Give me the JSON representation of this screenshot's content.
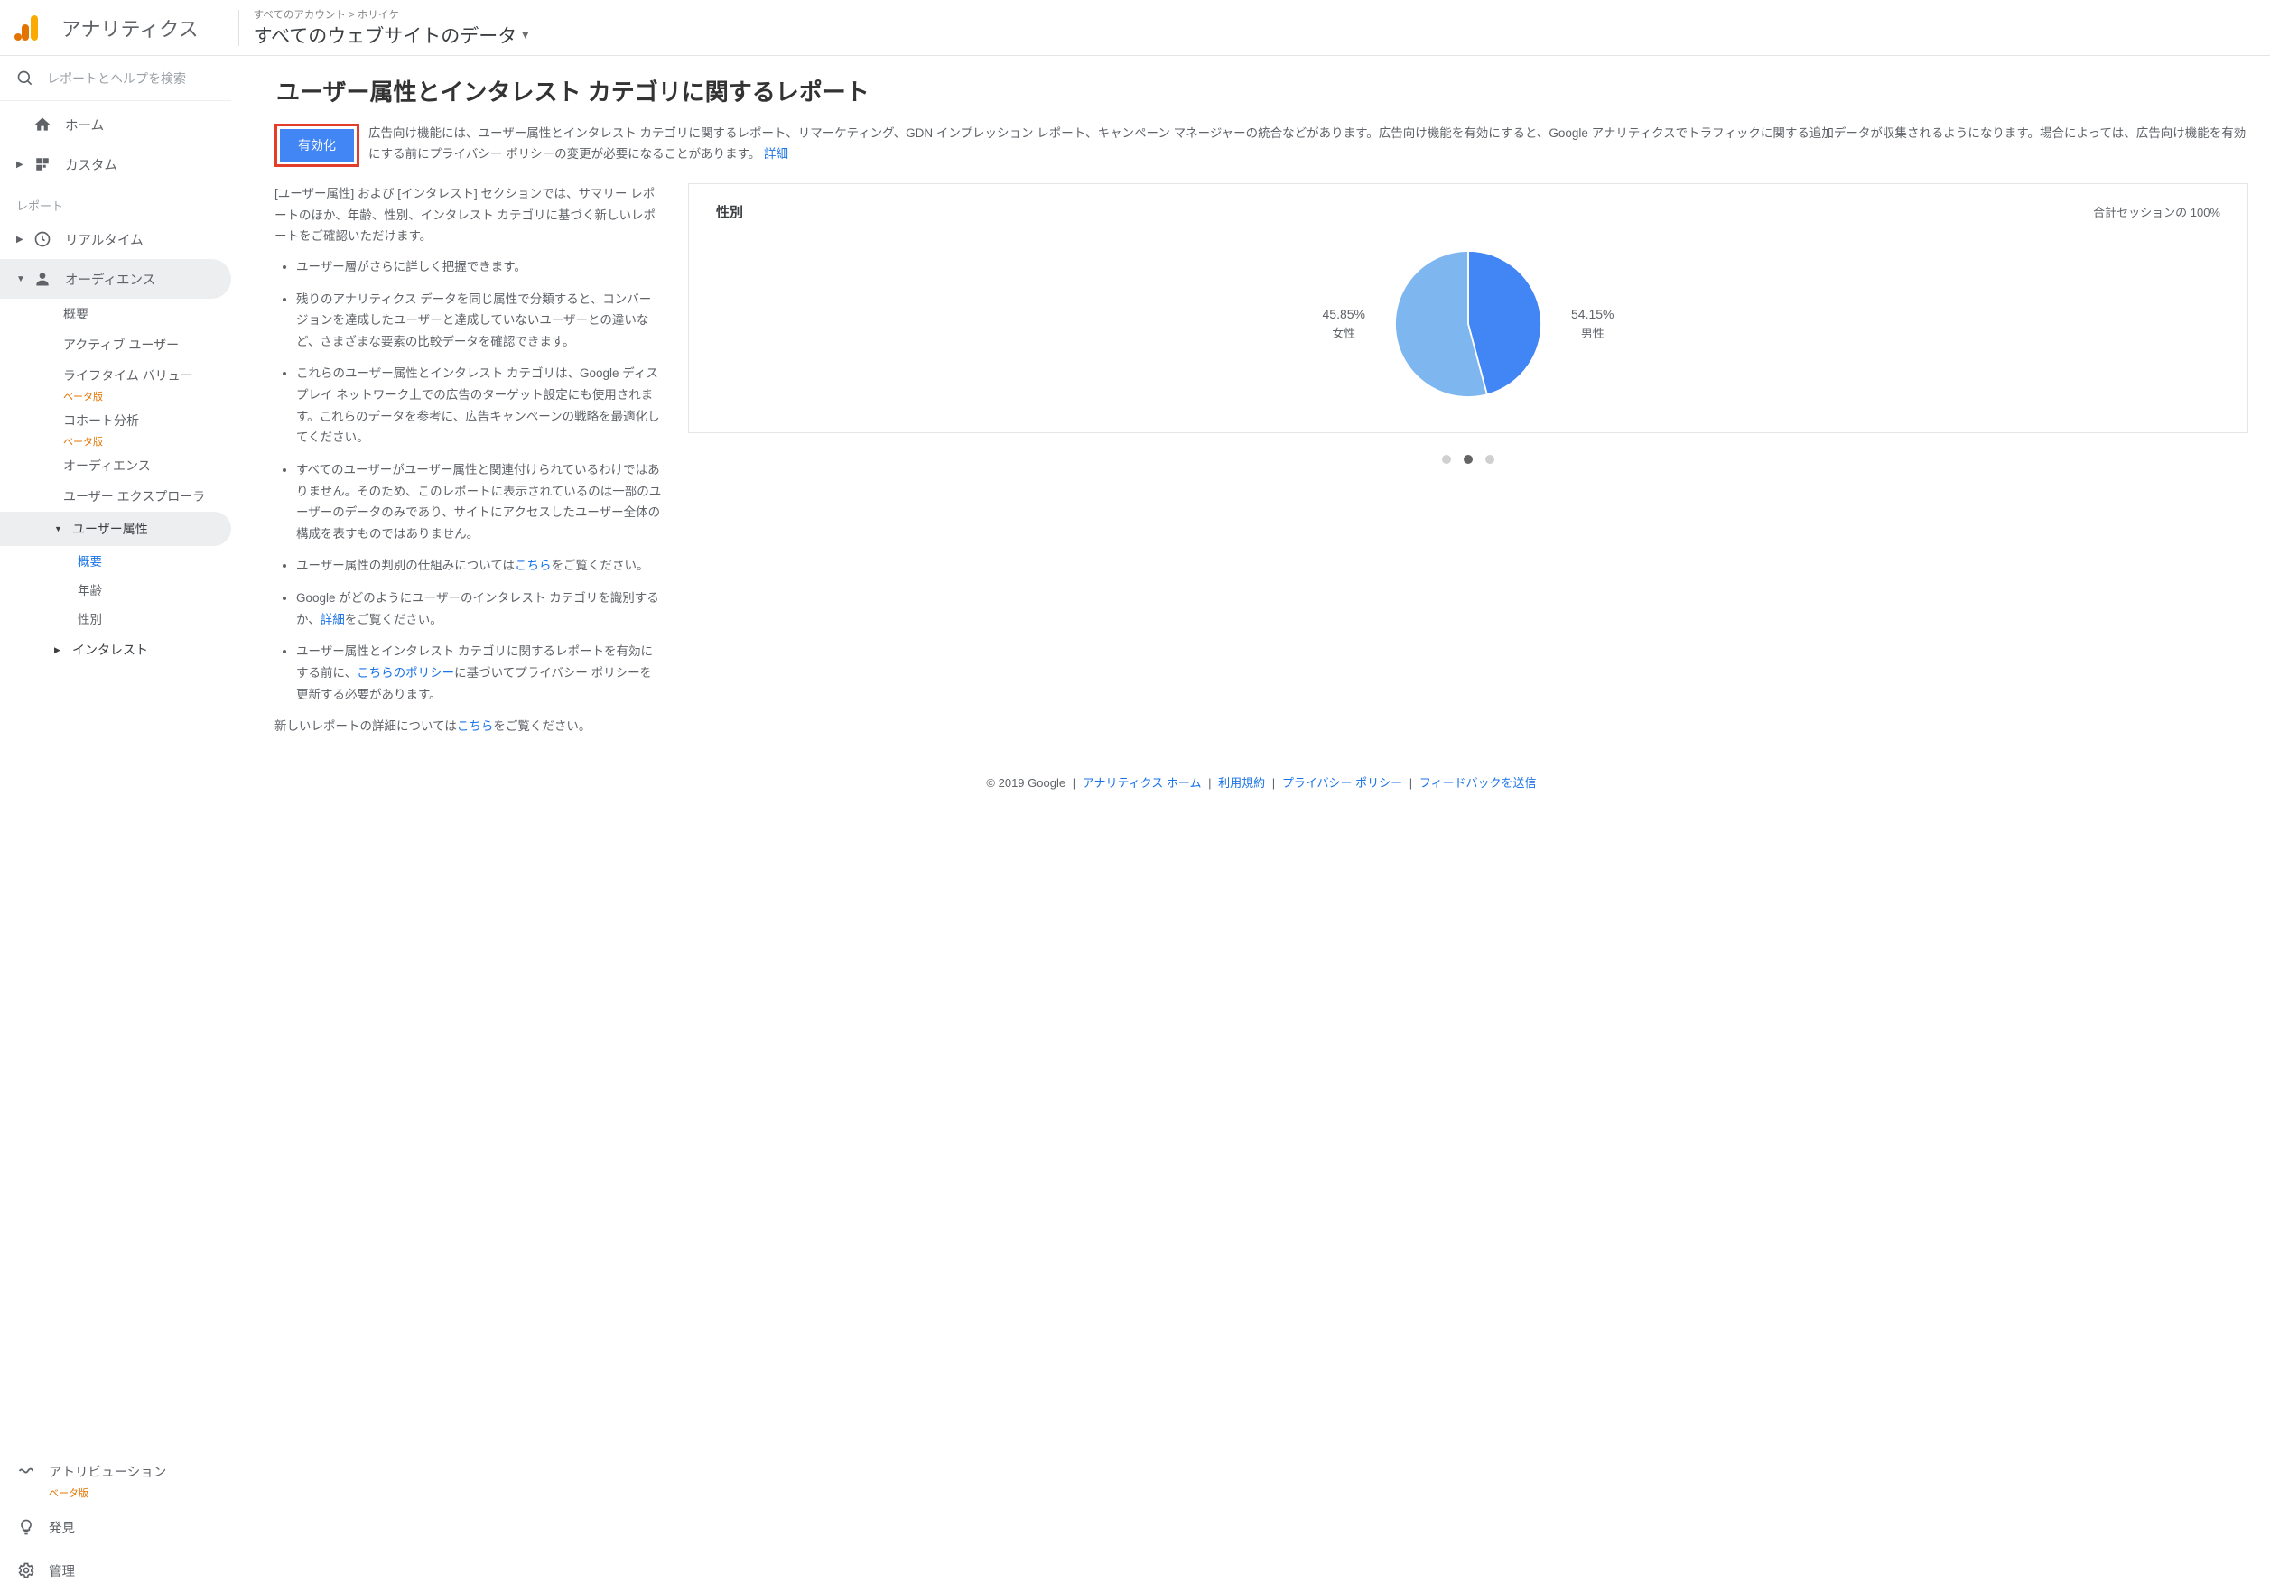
{
  "header": {
    "product_name": "アナリティクス",
    "breadcrumb_small": "すべてのアカウント > ホリイケ",
    "breadcrumb_title": "すべてのウェブサイトのデータ"
  },
  "search": {
    "placeholder": "レポートとヘルプを検索"
  },
  "nav": {
    "home": "ホーム",
    "custom": "カスタム",
    "section_label": "レポート",
    "realtime": "リアルタイム",
    "audience": "オーディエンス",
    "audience_sub": {
      "overview": "概要",
      "active_users": "アクティブ ユーザー",
      "lifetime_value": "ライフタイム バリュー",
      "beta": "ベータ版",
      "cohort": "コホート分析",
      "audiences": "オーディエンス",
      "user_explorer": "ユーザー エクスプローラ",
      "demographics": "ユーザー属性",
      "demo_overview": "概要",
      "demo_age": "年齢",
      "demo_gender": "性別",
      "interests": "インタレスト"
    },
    "attribution": "アトリビューション",
    "discover": "発見",
    "admin": "管理"
  },
  "main": {
    "title": "ユーザー属性とインタレスト カテゴリに関するレポート",
    "enable_button": "有効化",
    "intro": "広告向け機能には、ユーザー属性とインタレスト カテゴリに関するレポート、リマーケティング、GDN インプレッション レポート、キャンペーン マネージャーの統合などがあります。広告向け機能を有効にすると、Google アナリティクスでトラフィックに関する追加データが収集されるようになります。場合によっては、広告向け機能を有効にする前にプライバシー ポリシーの変更が必要になることがあります。",
    "intro_link": "詳細",
    "desc_intro": "[ユーザー属性] および [インタレスト] セクションでは、サマリー レポートのほか、年齢、性別、インタレスト カテゴリに基づく新しいレポートをご確認いただけます。",
    "bullets": [
      "ユーザー層がさらに詳しく把握できます。",
      "残りのアナリティクス データを同じ属性で分類すると、コンバージョンを達成したユーザーと達成していないユーザーとの違いなど、さまざまな要素の比較データを確認できます。",
      "これらのユーザー属性とインタレスト カテゴリは、Google ディスプレイ ネットワーク上での広告のターゲット設定にも使用されます。これらのデータを参考に、広告キャンペーンの戦略を最適化してください。",
      "すべてのユーザーがユーザー属性と関連付けられているわけではありません。そのため、このレポートに表示されているのは一部のユーザーのデータのみであり、サイトにアクセスしたユーザー全体の構成を表すものではありません。"
    ],
    "bullet5_a": "ユーザー属性の判別の仕組みについては",
    "bullet5_link": "こちら",
    "bullet5_b": "をご覧ください。",
    "bullet6_a": "Google がどのようにユーザーのインタレスト カテゴリを識別するか、",
    "bullet6_link": "詳細",
    "bullet6_b": "をご覧ください。",
    "bullet7_a": "ユーザー属性とインタレスト カテゴリに関するレポートを有効にする前に、",
    "bullet7_link": "こちらのポリシー",
    "bullet7_b": "に基づいてプライバシー ポリシーを更新する必要があります。",
    "closing_a": "新しいレポートの詳細については",
    "closing_link": "こちら",
    "closing_b": "をご覧ください。"
  },
  "chart_data": {
    "type": "pie",
    "title": "性別",
    "subtitle": "合計セッションの 100%",
    "series": [
      {
        "name": "女性",
        "value": 45.85,
        "color": "#4285f4"
      },
      {
        "name": "男性",
        "value": 54.15,
        "color": "#7eb6ef"
      }
    ],
    "active_dot": 1,
    "dot_count": 3
  },
  "footer": {
    "copyright": "© 2019 Google",
    "links": [
      "アナリティクス ホーム",
      "利用規約",
      "プライバシー ポリシー",
      "フィードバックを送信"
    ]
  }
}
